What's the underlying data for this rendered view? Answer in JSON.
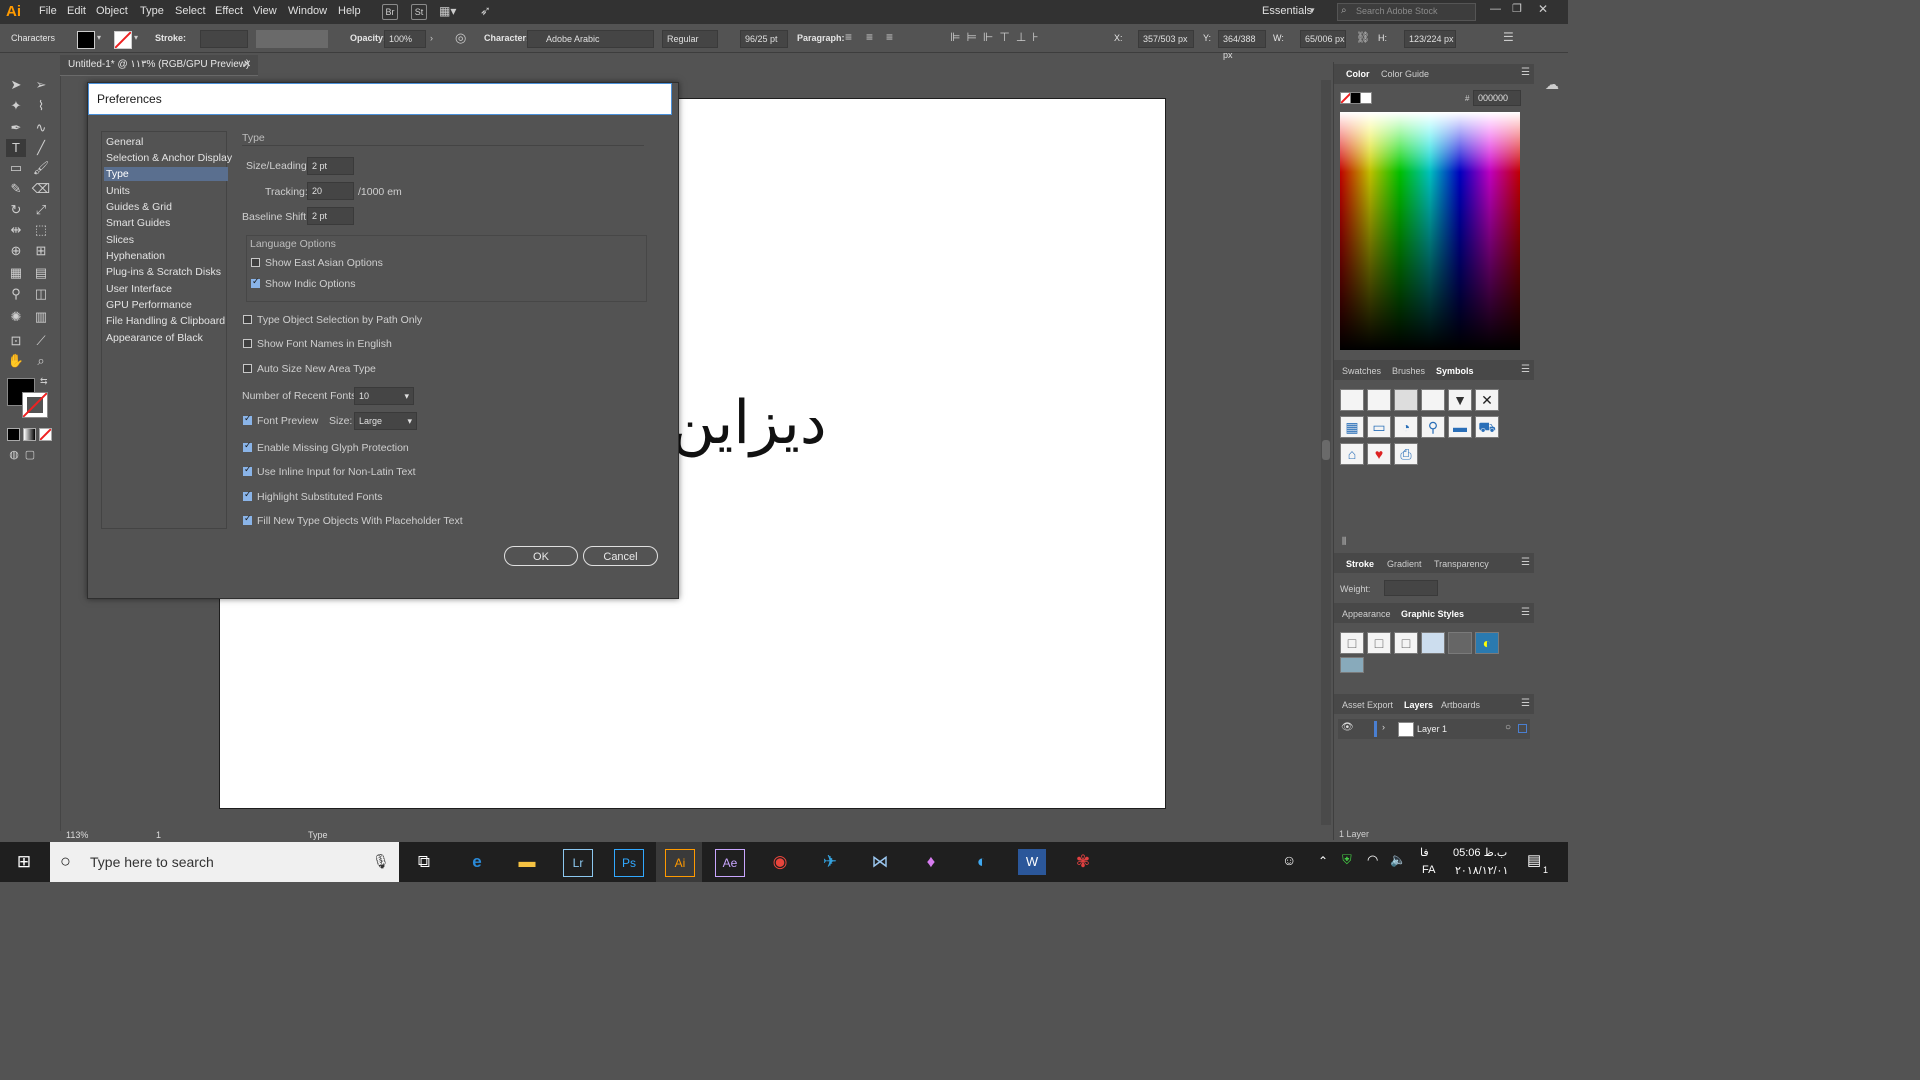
{
  "app": {
    "logo": "Ai",
    "menu": [
      "File",
      "Edit",
      "Object",
      "Type",
      "Select",
      "Effect",
      "View",
      "Window",
      "Help"
    ],
    "chips": [
      "Br",
      "St"
    ],
    "workspace": "Essentials",
    "search_placeholder": "Search Adobe Stock"
  },
  "control": {
    "panel_label": "Characters",
    "stroke_label": "Stroke:",
    "opacity_label": "Opacity:",
    "opacity_value": "100%",
    "character_label": "Character:",
    "font": "Adobe Arabic",
    "style": "Regular",
    "size": "96/25 pt",
    "paragraph_label": "Paragraph:",
    "x_label": "X:",
    "x_value": "357/503 px",
    "y_label": "Y:",
    "y_value": "364/388 px",
    "w_label": "W:",
    "w_value": "65/006 px",
    "h_label": "H:",
    "h_value": "123/224 px"
  },
  "document": {
    "tab_title": "Untitled-1* @ ۱۱۳% (RGB/GPU Preview)",
    "canvas_text": "دیزاین"
  },
  "dialog": {
    "title": "Preferences",
    "categories": [
      "General",
      "Selection & Anchor Display",
      "Type",
      "Units",
      "Guides & Grid",
      "Smart Guides",
      "Slices",
      "Hyphenation",
      "Plug-ins & Scratch Disks",
      "User Interface",
      "GPU Performance",
      "File Handling & Clipboard",
      "Appearance of Black"
    ],
    "selected_category": "Type",
    "section_title": "Type",
    "size_leading_label": "Size/Leading:",
    "size_leading_value": "2 pt",
    "tracking_label": "Tracking:",
    "tracking_value": "20",
    "tracking_unit": "/1000 em",
    "baseline_label": "Baseline Shift:",
    "baseline_value": "2 pt",
    "language_options_label": "Language Options",
    "east_asian": {
      "label": "Show East Asian Options",
      "checked": false
    },
    "indic": {
      "label": "Show Indic Options",
      "checked": true
    },
    "type_path_only": {
      "label": "Type Object Selection by Path Only",
      "checked": false
    },
    "font_names_english": {
      "label": "Show Font Names in English",
      "checked": false
    },
    "auto_size": {
      "label": "Auto Size New Area Type",
      "checked": false
    },
    "recent_fonts_label": "Number of Recent Fonts:",
    "recent_fonts_value": "10",
    "font_preview": {
      "label": "Font Preview",
      "checked": true
    },
    "preview_size_label": "Size:",
    "preview_size_value": "Large",
    "missing_glyph": {
      "label": "Enable Missing Glyph Protection",
      "checked": true
    },
    "inline_input": {
      "label": "Use Inline Input for Non-Latin Text",
      "checked": true
    },
    "highlight_fonts": {
      "label": "Highlight Substituted Fonts",
      "checked": true
    },
    "placeholder_text": {
      "label": "Fill New Type Objects With Placeholder Text",
      "checked": true
    },
    "ok_label": "OK",
    "cancel_label": "Cancel"
  },
  "panels": {
    "color_tabs": [
      "Color",
      "Color Guide"
    ],
    "hex_value": "000000",
    "library_tabs": [
      "Swatches",
      "Brushes",
      "Symbols"
    ],
    "stroke_tabs": [
      "Stroke",
      "Gradient",
      "Transparency"
    ],
    "weight_label": "Weight:",
    "appearance_tabs": [
      "Appearance",
      "Graphic Styles"
    ],
    "layer_tabs": [
      "Asset Export",
      "Layers",
      "Artboards"
    ],
    "layer_name": "Layer 1",
    "layers_count": "1 Layer"
  },
  "status": {
    "zoom": "113%",
    "artboard": "1",
    "tool": "Type"
  },
  "taskbar": {
    "search_placeholder": "Type here to search",
    "time": "05:06 ب.ظ",
    "date": "۲۰۱۸/۱۲/۰۱",
    "lang": "FA",
    "lang2": "فا",
    "notif_count": "1"
  },
  "colors": {
    "accent": "#ff9a00",
    "selection": "#5a6f8f",
    "checkbox": "#8ab4e8"
  }
}
